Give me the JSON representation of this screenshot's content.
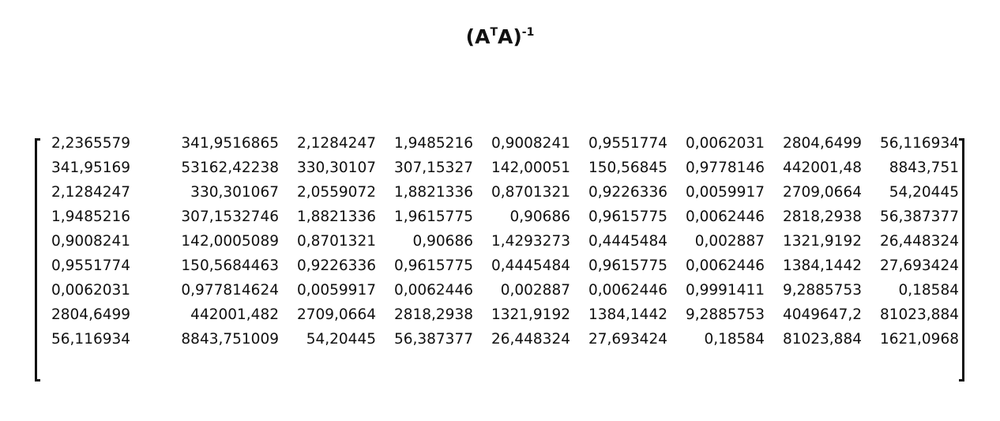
{
  "title": {
    "base": "(A",
    "sup_t": "T",
    "mid": "A)",
    "sup_inv": "-1"
  },
  "matrix": [
    [
      "2,2365579",
      "341,9516865",
      "2,1284247",
      "1,9485216",
      "0,9008241",
      "0,9551774",
      "0,0062031",
      "2804,6499",
      "56,116934"
    ],
    [
      "341,95169",
      "53162,42238",
      "330,30107",
      "307,15327",
      "142,00051",
      "150,56845",
      "0,9778146",
      "442001,48",
      "8843,751"
    ],
    [
      "2,1284247",
      "330,301067",
      "2,0559072",
      "1,8821336",
      "0,8701321",
      "0,9226336",
      "0,0059917",
      "2709,0664",
      "54,20445"
    ],
    [
      "1,9485216",
      "307,1532746",
      "1,8821336",
      "1,9615775",
      "0,90686",
      "0,9615775",
      "0,0062446",
      "2818,2938",
      "56,387377"
    ],
    [
      "0,9008241",
      "142,0005089",
      "0,8701321",
      "0,90686",
      "1,4293273",
      "0,4445484",
      "0,002887",
      "1321,9192",
      "26,448324"
    ],
    [
      "0,9551774",
      "150,5684463",
      "0,9226336",
      "0,9615775",
      "0,4445484",
      "0,9615775",
      "0,0062446",
      "1384,1442",
      "27,693424"
    ],
    [
      "0,0062031",
      "0,977814624",
      "0,0059917",
      "0,0062446",
      "0,002887",
      "0,0062446",
      "0,9991411",
      "9,2885753",
      "0,18584"
    ],
    [
      "2804,6499",
      "442001,482",
      "2709,0664",
      "2818,2938",
      "1321,9192",
      "1384,1442",
      "9,2885753",
      "4049647,2",
      "81023,884"
    ],
    [
      "56,116934",
      "8843,751009",
      "54,20445",
      "56,387377",
      "26,448324",
      "27,693424",
      "0,18584",
      "81023,884",
      "1621,0968"
    ]
  ]
}
